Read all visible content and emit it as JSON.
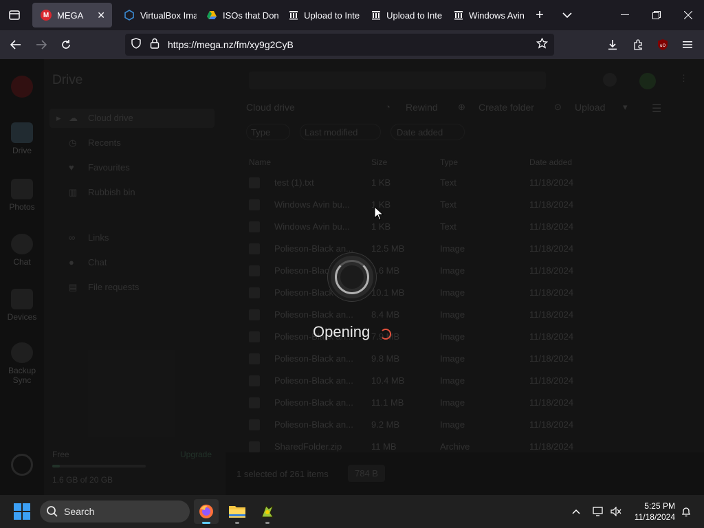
{
  "browser": {
    "tabs": [
      {
        "label": "MEGA",
        "icon": "mega-icon",
        "active": true
      },
      {
        "label": "VirtualBox Ima",
        "icon": "virtualbox-icon"
      },
      {
        "label": "ISOs that Don",
        "icon": "google-drive-icon"
      },
      {
        "label": "Upload to Inte",
        "icon": "archive-icon"
      },
      {
        "label": "Upload to Inte",
        "icon": "archive-icon"
      },
      {
        "label": "Windows Avin",
        "icon": "archive-icon"
      }
    ],
    "url": "https://mega.nz/fm/xy9g2CyB"
  },
  "mega": {
    "header_title": "Drive",
    "rail": [
      {
        "label": "Drive"
      },
      {
        "label": "Photos"
      },
      {
        "label": "Chat"
      },
      {
        "label": "Devices"
      },
      {
        "label": "Backup Sync"
      }
    ],
    "sidebar_items": [
      {
        "label": "Cloud drive"
      },
      {
        "label": "Recents"
      },
      {
        "label": "Favourites"
      },
      {
        "label": "Rubbish bin"
      },
      {
        "label": "Links"
      },
      {
        "label": "Chat"
      },
      {
        "label": "File requests"
      }
    ],
    "storage": {
      "label": "Free",
      "upgrade": "Upgrade",
      "used": "1.6 GB of 20 GB",
      "fraction": 0.08
    },
    "breadcrumb": "Cloud drive",
    "toolbar": {
      "rewind": "Rewind",
      "create_folder": "Create folder",
      "upload": "Upload"
    },
    "filters": [
      "Type",
      "Last modified",
      "Date added"
    ],
    "columns": {
      "name": "Name",
      "size": "Size",
      "type": "Type",
      "date": "Date added"
    },
    "files": [
      {
        "name": "test (1).txt",
        "size": "1 KB",
        "type": "Text",
        "date": "11/18/2024"
      },
      {
        "name": "Windows Avin bu...",
        "size": "1 KB",
        "type": "Text",
        "date": "11/18/2024"
      },
      {
        "name": "Windows Avin bu...",
        "size": "1 KB",
        "type": "Text",
        "date": "11/18/2024"
      },
      {
        "name": "Polieson-Black an...",
        "size": "12.5 MB",
        "type": "Image",
        "date": "11/18/2024"
      },
      {
        "name": "Polieson-Black an...",
        "size": "9.6 MB",
        "type": "Image",
        "date": "11/18/2024"
      },
      {
        "name": "Polieson-Black an...",
        "size": "10.1 MB",
        "type": "Image",
        "date": "11/18/2024"
      },
      {
        "name": "Polieson-Black an...",
        "size": "8.4 MB",
        "type": "Image",
        "date": "11/18/2024"
      },
      {
        "name": "Polieson-Black an...",
        "size": "7.9 MB",
        "type": "Image",
        "date": "11/18/2024"
      },
      {
        "name": "Polieson-Black an...",
        "size": "9.8 MB",
        "type": "Image",
        "date": "11/18/2024"
      },
      {
        "name": "Polieson-Black an...",
        "size": "10.4 MB",
        "type": "Image",
        "date": "11/18/2024"
      },
      {
        "name": "Polieson-Black an...",
        "size": "11.1 MB",
        "type": "Image",
        "date": "11/18/2024"
      },
      {
        "name": "Polieson-Black an...",
        "size": "9.2 MB",
        "type": "Image",
        "date": "11/18/2024"
      },
      {
        "name": "SharedFolder.zip",
        "size": "11 MB",
        "type": "Archive",
        "date": "11/18/2024"
      }
    ],
    "footer": {
      "selected": "1 selected of 261 items",
      "size": "784 B"
    },
    "loading_text": "Opening"
  },
  "taskbar": {
    "search_label": "Search",
    "time": "5:25 PM",
    "date": "11/18/2024"
  }
}
